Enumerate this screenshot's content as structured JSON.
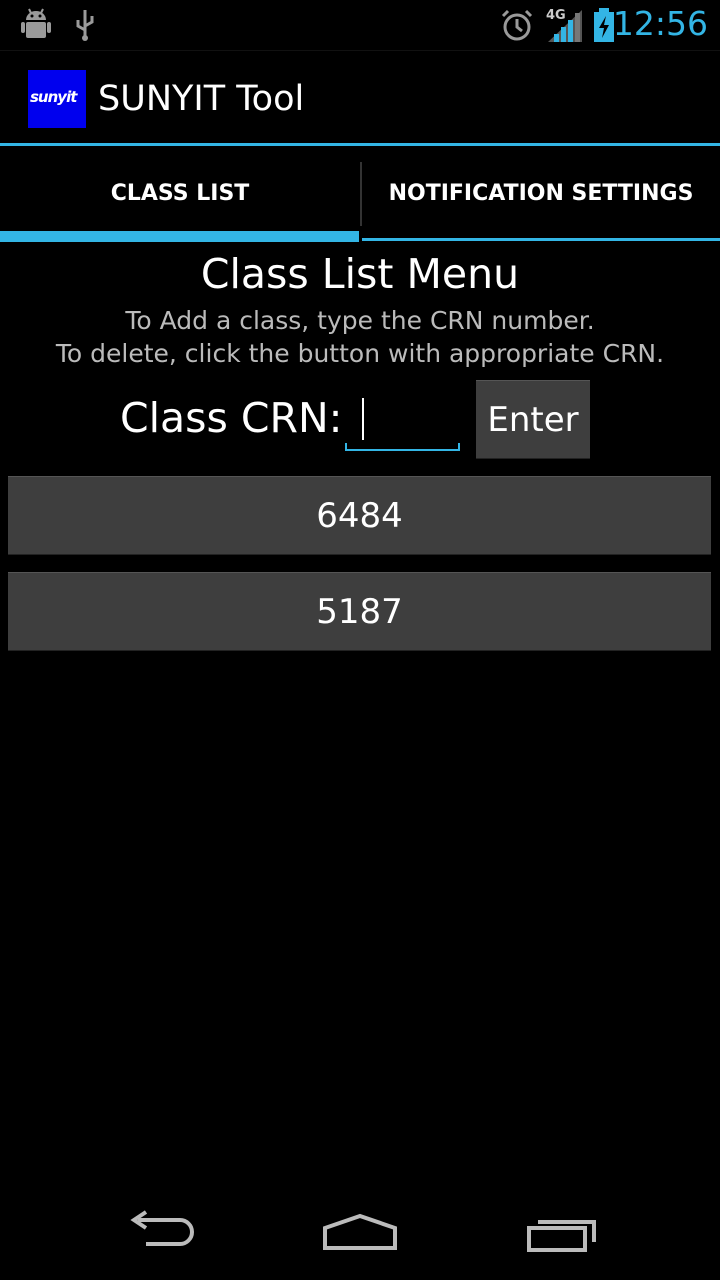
{
  "status_bar": {
    "time": "12:56",
    "network": "4G",
    "icons": [
      "android-debug-icon",
      "usb-icon",
      "alarm-icon",
      "signal-icon",
      "battery-charging-icon"
    ],
    "accent_color": "#33b5e5"
  },
  "action_bar": {
    "logo_text": "sunyit",
    "title": "SUNYIT Tool"
  },
  "tabs": [
    {
      "label": "CLASS LIST",
      "selected": true
    },
    {
      "label": "NOTIFICATION SETTINGS",
      "selected": false
    }
  ],
  "content": {
    "title": "Class List Menu",
    "instruction_1": "To Add a class, type the CRN number.",
    "instruction_2": "To delete, click the button with appropriate CRN.",
    "crn_label": "Class CRN:",
    "crn_value": "",
    "enter_label": "Enter",
    "classes": [
      "6484",
      "5187"
    ]
  },
  "nav_bar": {
    "icons": [
      "back-icon",
      "home-icon",
      "recent-apps-icon"
    ]
  }
}
